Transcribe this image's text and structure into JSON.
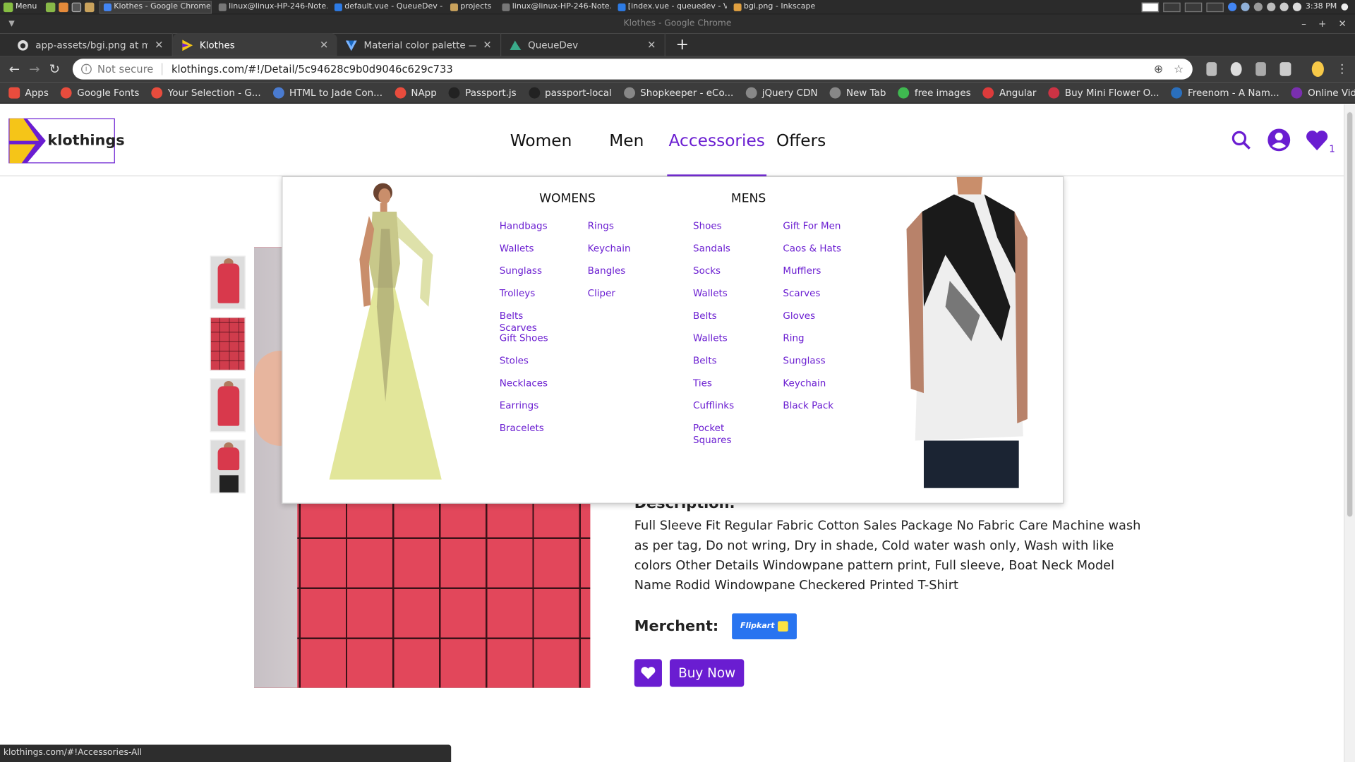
{
  "taskbar": {
    "menu_label": "Menu",
    "tasks": [
      {
        "label": "Klothes - Google Chrome",
        "color": "#4285f4",
        "active": true
      },
      {
        "label": "linux@linux-HP-246-Note...",
        "color": "#777777",
        "active": false
      },
      {
        "label": "default.vue - QueueDev -...",
        "color": "#2d7be5",
        "active": false
      },
      {
        "label": "projects",
        "color": "#c9a25c",
        "active": false
      },
      {
        "label": "linux@linux-HP-246-Note...",
        "color": "#777777",
        "active": false
      },
      {
        "label": "[index.vue - queuedev - V...",
        "color": "#2d7be5",
        "active": false
      },
      {
        "label": "bgi.png - Inkscape",
        "color": "#e0a040",
        "active": false
      }
    ],
    "clock": "3:38 PM"
  },
  "window": {
    "title": "Klothes - Google Chrome"
  },
  "tabs": [
    {
      "label": "app-assets/bgi.png at master ·",
      "icon": "github-icon",
      "active": false
    },
    {
      "label": "Klothes",
      "icon": "klothes-favicon-icon",
      "active": true
    },
    {
      "label": "Material color palette — Vuetify",
      "icon": "vuetify-icon",
      "active": false
    },
    {
      "label": "QueueDev",
      "icon": "queuedev-icon",
      "active": false
    }
  ],
  "address": {
    "security": "Not secure",
    "url": "klothings.com/#!/Detail/5c94628c9b0d9046c629c733"
  },
  "bookmarks": [
    {
      "label": "Apps",
      "color": "#e84c3d"
    },
    {
      "label": "Google Fonts",
      "color": "#e84c3d"
    },
    {
      "label": "Your Selection - G...",
      "color": "#e84c3d"
    },
    {
      "label": "HTML to Jade Con...",
      "color": "#4a7bd0"
    },
    {
      "label": "NApp",
      "color": "#e84c3d"
    },
    {
      "label": "Passport.js",
      "color": "#222222"
    },
    {
      "label": "passport-local",
      "color": "#222222"
    },
    {
      "label": "Shopkeeper - eCo...",
      "color": "#888888"
    },
    {
      "label": "jQuery CDN",
      "color": "#888888"
    },
    {
      "label": "New Tab",
      "color": "#888888"
    },
    {
      "label": "free images",
      "color": "#3fb950"
    },
    {
      "label": "Angular",
      "color": "#dd3b3b"
    },
    {
      "label": "Buy Mini Flower O...",
      "color": "#cc3344"
    },
    {
      "label": "Freenom - A Nam...",
      "color": "#2a6fbd"
    },
    {
      "label": "Online Video Dow...",
      "color": "#7a2fb0"
    }
  ],
  "site": {
    "logo_text": "klothings",
    "nav": [
      {
        "label": "Women",
        "active": false
      },
      {
        "label": "Men",
        "active": false
      },
      {
        "label": "Accessories",
        "active": true
      },
      {
        "label": "Offers",
        "active": false
      }
    ],
    "wishlist_count": "1",
    "accent_color": "#6a1dd1"
  },
  "mega_menu": {
    "womens": {
      "title": "WOMENS",
      "col1": [
        "Handbags",
        "Wallets",
        "Sunglass",
        "Trolleys",
        "Belts Scarves",
        "Gift Shoes",
        "Stoles",
        "Necklaces",
        "Earrings",
        "Bracelets"
      ],
      "col2": [
        "Rings",
        "Keychain",
        "Bangles",
        "Cliper"
      ]
    },
    "mens": {
      "title": "MENS",
      "col1": [
        "Shoes",
        "Sandals",
        "Socks",
        "Wallets",
        "Belts",
        "Wallets",
        "Belts",
        "Ties",
        "Cufflinks",
        "Pocket Squares"
      ],
      "col2": [
        "Gift For Men",
        "Caos & Hats",
        "Mufflers",
        "Scarves",
        "Gloves",
        "Ring",
        "Sunglass",
        "Keychain",
        "Black Pack"
      ]
    }
  },
  "product": {
    "description_title": "Description:",
    "description": "Full Sleeve Fit Regular Fabric Cotton Sales Package No Fabric Care Machine wash as per tag, Do not wring, Dry in shade, Cold water wash only, Wash with like colors Other Details Windowpane pattern print, Full sleeve, Boat Neck Model Name Rodid Windowpane Checkered Printed T-Shirt",
    "merchant_label": "Merchent:",
    "merchant_name": "Flipkart",
    "buy_label": "Buy Now"
  },
  "status_url": "klothings.com/#!Accessories-All"
}
